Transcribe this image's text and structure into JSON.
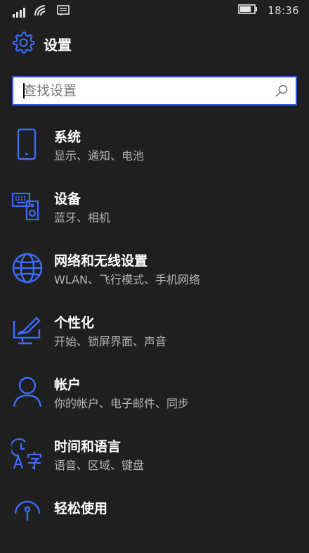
{
  "status_bar": {
    "time": "18:36",
    "icons": [
      "signal-bars-icon",
      "wifi-icon",
      "message-icon",
      "battery-icon"
    ]
  },
  "header": {
    "icon": "gear-icon",
    "title": "设置"
  },
  "search": {
    "placeholder": "查找设置",
    "icon": "search-icon"
  },
  "accent_color": "#2f58e6",
  "items": [
    {
      "icon": "phone-icon",
      "title": "系统",
      "subtitle": "显示、通知、电池"
    },
    {
      "icon": "devices-icon",
      "title": "设备",
      "subtitle": "蓝牙、相机"
    },
    {
      "icon": "globe-icon",
      "title": "网络和无线设置",
      "subtitle": "WLAN、飞行模式、手机网络"
    },
    {
      "icon": "personalization-icon",
      "title": "个性化",
      "subtitle": "开始、锁屏界面、声音"
    },
    {
      "icon": "person-icon",
      "title": "帐户",
      "subtitle": "你的帐户、电子邮件、同步"
    },
    {
      "icon": "time-language-icon",
      "title": "时间和语言",
      "subtitle": "语音、区域、键盘"
    },
    {
      "icon": "ease-of-access-icon",
      "title": "轻松使用",
      "subtitle": ""
    }
  ]
}
